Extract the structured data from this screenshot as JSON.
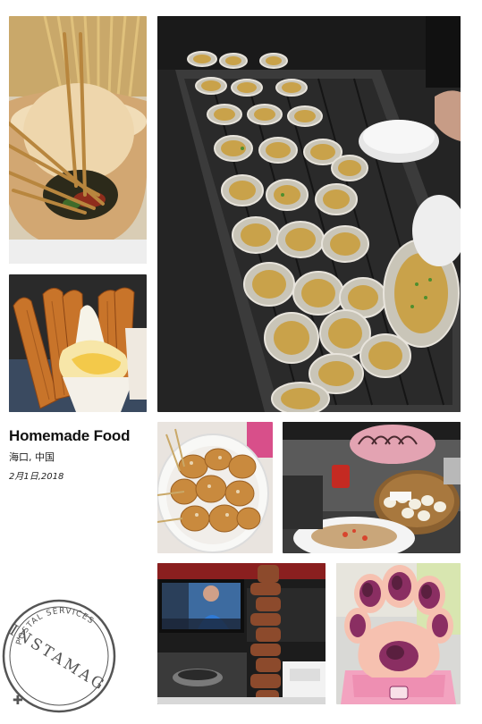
{
  "caption": {
    "title": "Homemade Food",
    "location": "海口, 中国",
    "date": "2月1日,2018"
  },
  "stamp": {
    "top_text": "POSTAL SERVICES",
    "main_text": "INSTAMAG"
  },
  "colors": {
    "background": "#ffffff",
    "stamp_ink": "#555555",
    "caption_text": "#111111"
  },
  "photos": [
    {
      "name": "photo-skewers-in-cup"
    },
    {
      "name": "photo-grilled-oysters"
    },
    {
      "name": "photo-churros-ice-cream"
    },
    {
      "name": "photo-fried-chicken-bowl"
    },
    {
      "name": "photo-grill-station"
    },
    {
      "name": "photo-tv-food-stall"
    },
    {
      "name": "photo-paw-dessert"
    }
  ]
}
